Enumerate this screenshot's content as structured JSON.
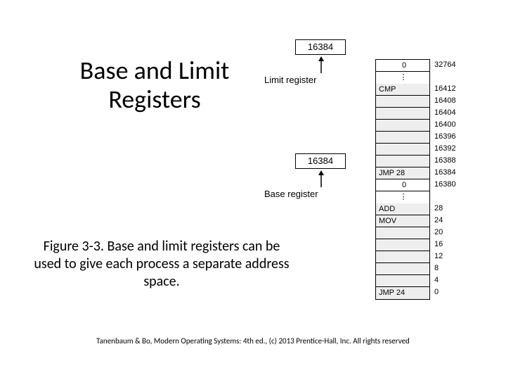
{
  "title": "Base and Limit Registers",
  "caption": "Figure 3-3. Base and limit registers can be used to give each process a separate address space.",
  "footer": "Tanenbaum & Bo, Modern Operating Systems: 4th ed., (c) 2013 Prentice-Hall, Inc. All rights reserved",
  "limit": {
    "value": "16384",
    "label": "Limit register"
  },
  "base": {
    "value": "16384",
    "label": "Base register"
  },
  "memory_top_instruction": "0",
  "memory_rows_upper": [
    {
      "instr": "",
      "addr": "32764"
    },
    {
      "instr": "CMP",
      "addr": "16412"
    },
    {
      "instr": "",
      "addr": "16408"
    },
    {
      "instr": "",
      "addr": "16404"
    },
    {
      "instr": "",
      "addr": "16400"
    },
    {
      "instr": "",
      "addr": "16396"
    },
    {
      "instr": "",
      "addr": "16392"
    },
    {
      "instr": "",
      "addr": "16388"
    },
    {
      "instr": "JMP 28",
      "addr": "16384"
    },
    {
      "instr": "0",
      "addr": "16380"
    }
  ],
  "memory_rows_lower": [
    {
      "instr": "ADD",
      "addr": "28"
    },
    {
      "instr": "MOV",
      "addr": "24"
    },
    {
      "instr": "",
      "addr": "20"
    },
    {
      "instr": "",
      "addr": "16"
    },
    {
      "instr": "",
      "addr": "12"
    },
    {
      "instr": "",
      "addr": "8"
    },
    {
      "instr": "",
      "addr": "4"
    },
    {
      "instr": "JMP 24",
      "addr": "0"
    }
  ]
}
